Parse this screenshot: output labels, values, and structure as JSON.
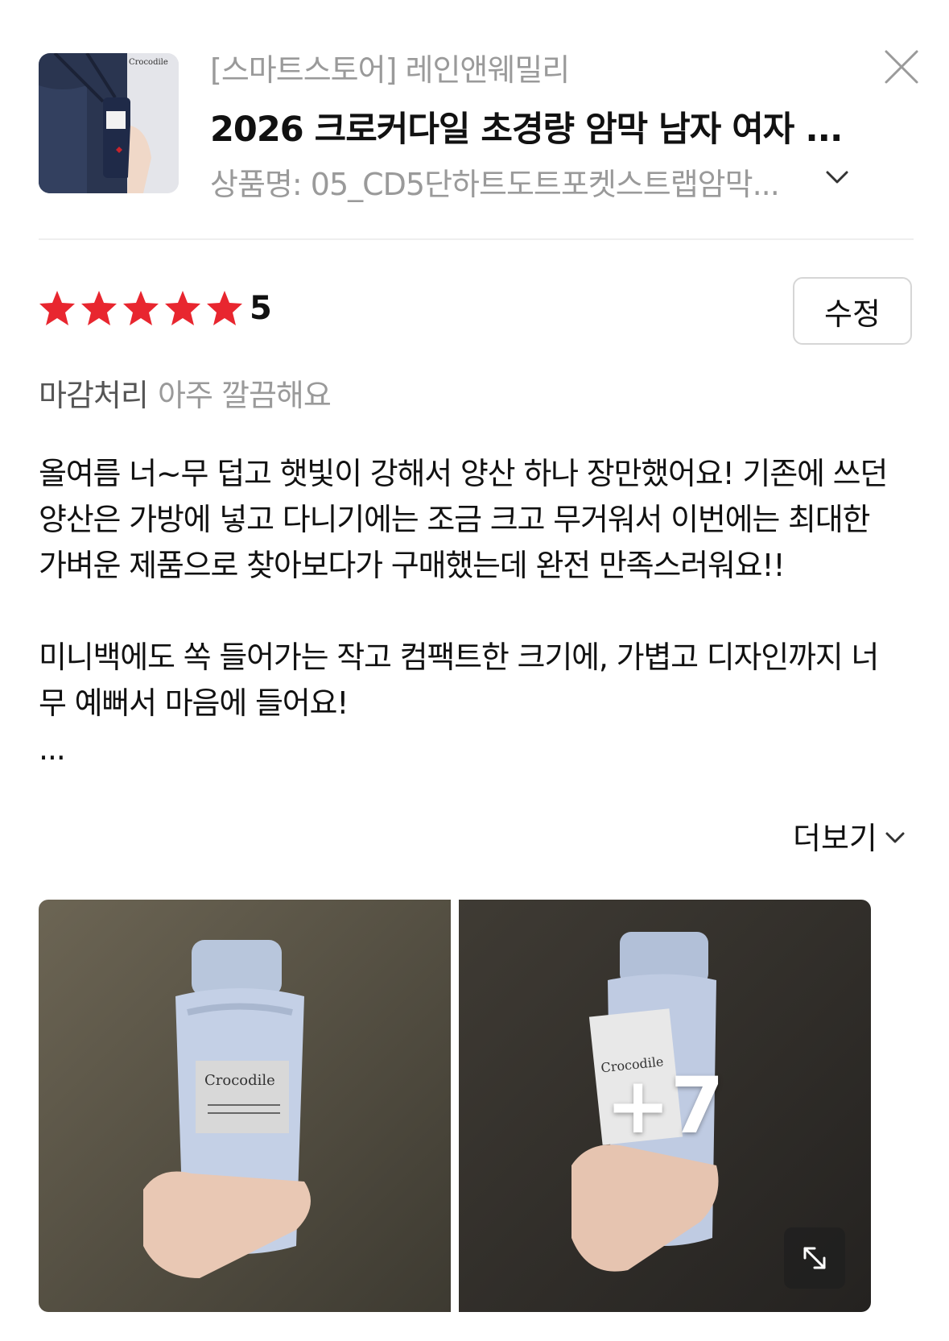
{
  "product": {
    "store": "[스마트스토어] 레인앤웨밀리",
    "title": "2026 크로커다일 초경량 암막 남자 여자 ...",
    "option": "상품명: 05_CD5단하트도트포켓스트랩암막...",
    "thumbnail_icon": "umbrella-product-thumbnail"
  },
  "rating": {
    "stars": 5,
    "score": "5",
    "star_color": "#e8262f",
    "edit_label": "수정"
  },
  "attribute": {
    "key": "마감처리",
    "value": "아주 깔끔해요"
  },
  "review": {
    "lines": [
      "올여름 너~무 덥고 햇빛이 강해서 양산 하나 장만했어요! 기존에 쓰던",
      "양산은 가방에 넣고 다니기에는 조금 크고 무거워서 이번에는 최대한",
      "가벼운 제품으로 찾아보다가 구매했는데 완전 만족스러워요!!",
      "",
      "미니백에도 쏙 들어가는 작고 컴팩트한 크기에, 가볍고 디자인까지 너",
      "무 예뻐서 마음에 들어요!",
      "..."
    ],
    "more_label": "더보기"
  },
  "photos": {
    "extra_count": "+7",
    "items": [
      "review-photo-umbrella-front",
      "review-photo-umbrella-with-tag"
    ]
  },
  "icons": {
    "close": "close-icon",
    "chevron": "chevron-down-icon",
    "expand": "expand-icon"
  }
}
